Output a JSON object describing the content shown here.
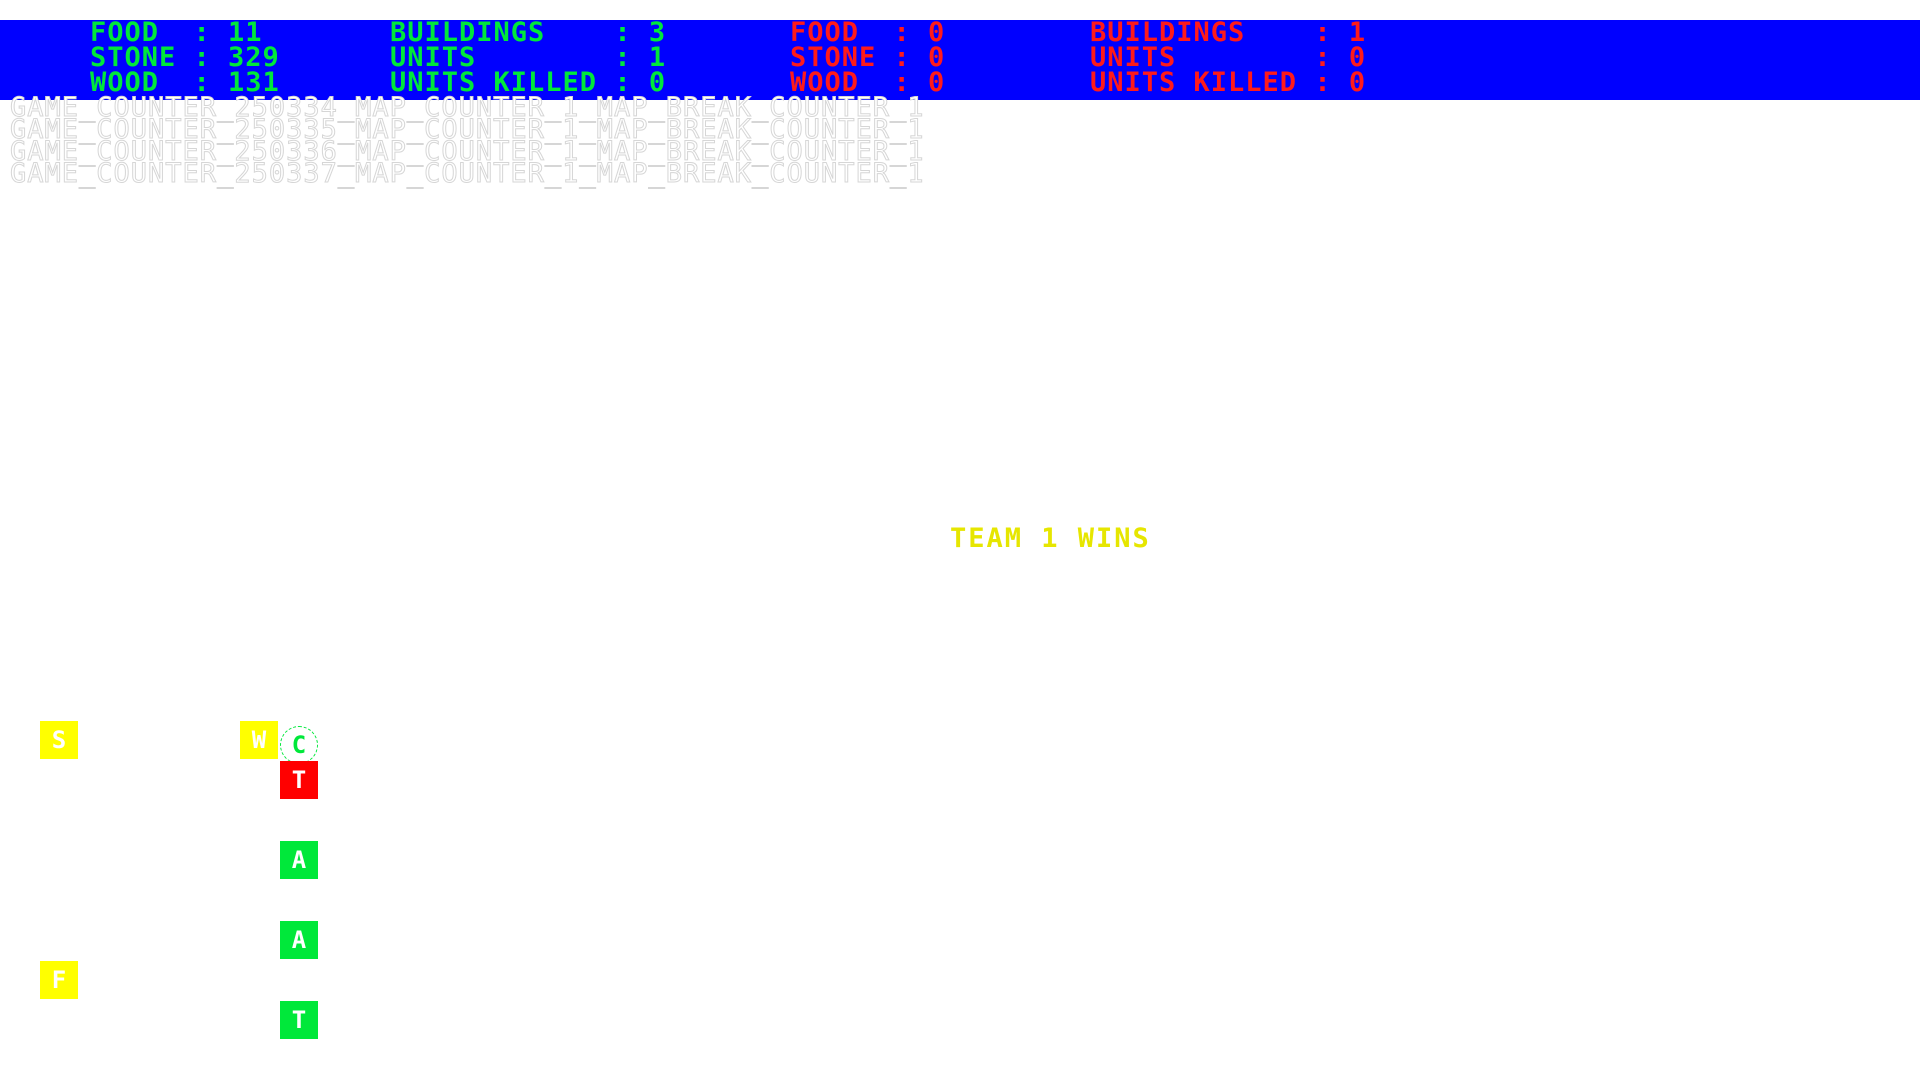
{
  "hud": {
    "team1": {
      "food": "FOOD  : 11",
      "stone": "STONE : 329",
      "wood": "WOOD  : 131",
      "buildings": "BUILDINGS    : 3",
      "units": "UNITS        : 1",
      "units_killed": "UNITS KILLED : 0"
    },
    "team2": {
      "food": "FOOD  : 0",
      "stone": "STONE : 0",
      "wood": "WOOD  : 0",
      "buildings": "BUILDINGS    : 1",
      "units": "UNITS        : 0",
      "units_killed": "UNITS KILLED : 0"
    },
    "colors": {
      "background": "#0000ff",
      "team1": "#00e83a",
      "team2": "#ff1a1a"
    }
  },
  "log": [
    "GAME_COUNTER_250334_MAP_COUNTER_1_MAP_BREAK_COUNTER_1",
    "GAME_COUNTER_250335_MAP_COUNTER_1_MAP_BREAK_COUNTER_1",
    "GAME_COUNTER_250336_MAP_COUNTER_1_MAP_BREAK_COUNTER_1",
    "GAME_COUNTER_250337_MAP_COUNTER_1_MAP_BREAK_COUNTER_1"
  ],
  "status": {
    "message": "TEAM 1 WINS",
    "color": "#e6e600"
  },
  "map": {
    "tiles": {
      "stone": "S",
      "wood": "W",
      "city": "C",
      "tower_enemy": "T",
      "archer_1": "A",
      "archer_2": "A",
      "food": "F",
      "tower_own": "T"
    }
  }
}
